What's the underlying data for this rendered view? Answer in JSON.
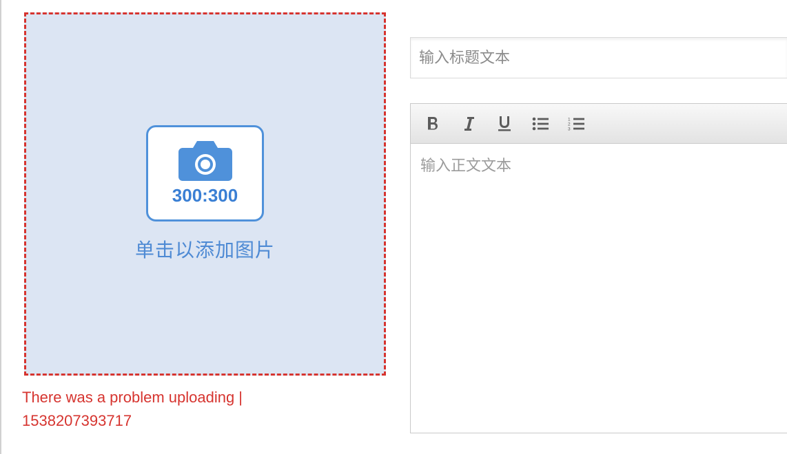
{
  "upload": {
    "dimensions": "300:300",
    "hint": "单击以添加图片",
    "error": "There was a problem uploading | 1538207393717",
    "icon": "camera-icon"
  },
  "title_field": {
    "placeholder": "输入标题文本",
    "value": ""
  },
  "editor": {
    "placeholder": "输入正文文本",
    "toolbar": {
      "bold": "bold",
      "italic": "italic",
      "underline": "underline",
      "ul": "unordered-list",
      "ol": "ordered-list"
    }
  },
  "colors": {
    "error": "#d6342f",
    "accent": "#4f91da",
    "dropzone_bg": "#dce5f3"
  }
}
